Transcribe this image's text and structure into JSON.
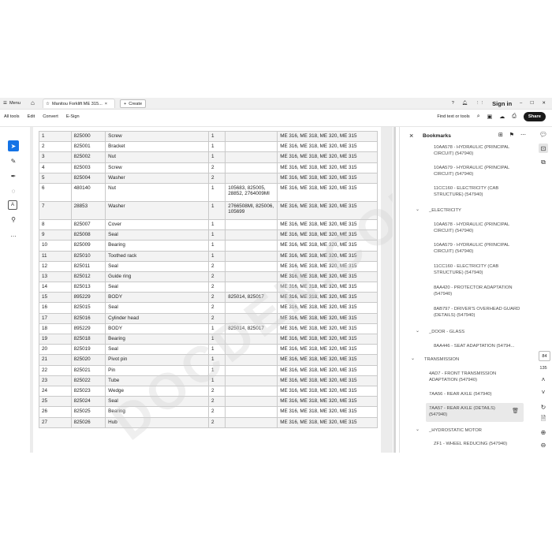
{
  "tabbar": {
    "menu_label": "Menu",
    "doc_tab_title": "Manitou Forklift ME 315...",
    "create_label": "Create",
    "signin_label": "Sign in"
  },
  "toolbar": {
    "items": [
      "All tools",
      "Edit",
      "Convert",
      "E-Sign"
    ],
    "find_label": "Find text or tools",
    "share_label": "Share"
  },
  "table": {
    "rows": [
      {
        "idx": "1",
        "code": "825000",
        "name": "Screw",
        "qty": "1",
        "ref": "",
        "models": "ME 316, ME 318, ME 320, ME 315"
      },
      {
        "idx": "2",
        "code": "825001",
        "name": "Bracket",
        "qty": "1",
        "ref": "",
        "models": "ME 316, ME 318, ME 320, ME 315"
      },
      {
        "idx": "3",
        "code": "825002",
        "name": "Nut",
        "qty": "1",
        "ref": "",
        "models": "ME 316, ME 318, ME 320, ME 315"
      },
      {
        "idx": "4",
        "code": "825003",
        "name": "Screw",
        "qty": "2",
        "ref": "",
        "models": "ME 316, ME 318, ME 320, ME 315"
      },
      {
        "idx": "5",
        "code": "825004",
        "name": "Washer",
        "qty": "2",
        "ref": "",
        "models": "ME 316, ME 318, ME 320, ME 315"
      },
      {
        "idx": "6",
        "code": "480140",
        "name": "Nut",
        "qty": "1",
        "ref": "105683, 825005, 28852, 2764009MI",
        "models": "ME 316, ME 318, ME 320, ME 315",
        "tall": true
      },
      {
        "idx": "7",
        "code": "28853",
        "name": "Washer",
        "qty": "1",
        "ref": "2766508MI, 825006, 105699",
        "models": "ME 316, ME 318, ME 320, ME 315",
        "tall": true
      },
      {
        "idx": "8",
        "code": "825007",
        "name": "Cover",
        "qty": "1",
        "ref": "",
        "models": "ME 316, ME 318, ME 320, ME 315"
      },
      {
        "idx": "9",
        "code": "825008",
        "name": "Seal",
        "qty": "1",
        "ref": "",
        "models": "ME 316, ME 318, ME 320, ME 315"
      },
      {
        "idx": "10",
        "code": "825009",
        "name": "Bearing",
        "qty": "1",
        "ref": "",
        "models": "ME 316, ME 318, ME 320, ME 315"
      },
      {
        "idx": "11",
        "code": "825010",
        "name": "Toothed rack",
        "qty": "1",
        "ref": "",
        "models": "ME 316, ME 318, ME 320, ME 315"
      },
      {
        "idx": "12",
        "code": "825011",
        "name": "Seal",
        "qty": "2",
        "ref": "",
        "models": "ME 316, ME 318, ME 320, ME 315"
      },
      {
        "idx": "13",
        "code": "825012",
        "name": "Guide ring",
        "qty": "2",
        "ref": "",
        "models": "ME 316, ME 318, ME 320, ME 315"
      },
      {
        "idx": "14",
        "code": "825013",
        "name": "Seal",
        "qty": "2",
        "ref": "",
        "models": "ME 316, ME 318, ME 320, ME 315"
      },
      {
        "idx": "15",
        "code": "895229",
        "name": "BODY",
        "qty": "2",
        "ref": "825014, 825017",
        "models": "ME 316, ME 318, ME 320, ME 315"
      },
      {
        "idx": "16",
        "code": "825015",
        "name": "Seal",
        "qty": "2",
        "ref": "",
        "models": "ME 316, ME 318, ME 320, ME 315"
      },
      {
        "idx": "17",
        "code": "825016",
        "name": "Cylinder head",
        "qty": "2",
        "ref": "",
        "models": "ME 316, ME 318, ME 320, ME 315"
      },
      {
        "idx": "18",
        "code": "895229",
        "name": "BODY",
        "qty": "1",
        "ref": "825014, 825017",
        "models": "ME 316, ME 318, ME 320, ME 315"
      },
      {
        "idx": "19",
        "code": "825018",
        "name": "Bearing",
        "qty": "1",
        "ref": "",
        "models": "ME 316, ME 318, ME 320, ME 315"
      },
      {
        "idx": "20",
        "code": "825019",
        "name": "Seal",
        "qty": "1",
        "ref": "",
        "models": "ME 316, ME 318, ME 320, ME 315"
      },
      {
        "idx": "21",
        "code": "825020",
        "name": "Pivot pin",
        "qty": "1",
        "ref": "",
        "models": "ME 316, ME 318, ME 320, ME 315"
      },
      {
        "idx": "22",
        "code": "825021",
        "name": "Pin",
        "qty": "1",
        "ref": "",
        "models": "ME 316, ME 318, ME 320, ME 315"
      },
      {
        "idx": "23",
        "code": "825022",
        "name": "Tube",
        "qty": "1",
        "ref": "",
        "models": "ME 316, ME 318, ME 320, ME 315"
      },
      {
        "idx": "24",
        "code": "825023",
        "name": "Wedge",
        "qty": "2",
        "ref": "",
        "models": "ME 316, ME 318, ME 320, ME 315"
      },
      {
        "idx": "25",
        "code": "825024",
        "name": "Seal",
        "qty": "2",
        "ref": "",
        "models": "ME 316, ME 318, ME 320, ME 315"
      },
      {
        "idx": "26",
        "code": "825025",
        "name": "Bearing",
        "qty": "2",
        "ref": "",
        "models": "ME 316, ME 318, ME 320, ME 315"
      },
      {
        "idx": "27",
        "code": "825026",
        "name": "Hub",
        "qty": "2",
        "ref": "",
        "models": "ME 316, ME 318, ME 320, ME 315"
      }
    ]
  },
  "watermark": "DOCDEN.COM",
  "bookmarks": {
    "title": "Bookmarks",
    "items": [
      {
        "text": "10AA578 - HYDRAULIC (PRINCIPAL CIRCUIT) (547940)"
      },
      {
        "text": "10AA579 - HYDRAULIC (PRINCIPAL CIRCUIT) (547940)"
      },
      {
        "text": "11CC160 - ELECTRICITY (CAB STRUCTURE) (547940)"
      },
      {
        "text": "_ELECTRICITY"
      },
      {
        "text": "10AA578 - HYDRAULIC (PRINCIPAL CIRCUIT) (547940)"
      },
      {
        "text": "10AA579 - HYDRAULIC (PRINCIPAL CIRCUIT) (547940)"
      },
      {
        "text": "11CC160 - ELECTRICITY (CAB STRUCTURE) (547940)"
      },
      {
        "text": "8AA420 - PROTECTOR ADAPTATION (547940)"
      },
      {
        "text": "8AB797 - DRIVER'S OVERHEAD GUARD (DETAILS) (547940)"
      },
      {
        "text": "_DOOR - GLASS"
      },
      {
        "text": "8AA446 - SEAT ADAPTATION (54794..."
      },
      {
        "text": "TRANSMISSION"
      },
      {
        "text": "4AD7 - FRONT TRANSMISSION ADAPTATION (547940)"
      },
      {
        "text": "7AA56 - REAR AXLE (547940)"
      },
      {
        "text": "7AA57 - REAR AXLE (DETAILS) (547940)"
      },
      {
        "text": "_HYDROSTATIC MOTOR"
      },
      {
        "text": "ZF1 - WHEEL REDUCING (547940)"
      }
    ]
  },
  "pager": {
    "current": "84",
    "total": "135"
  }
}
